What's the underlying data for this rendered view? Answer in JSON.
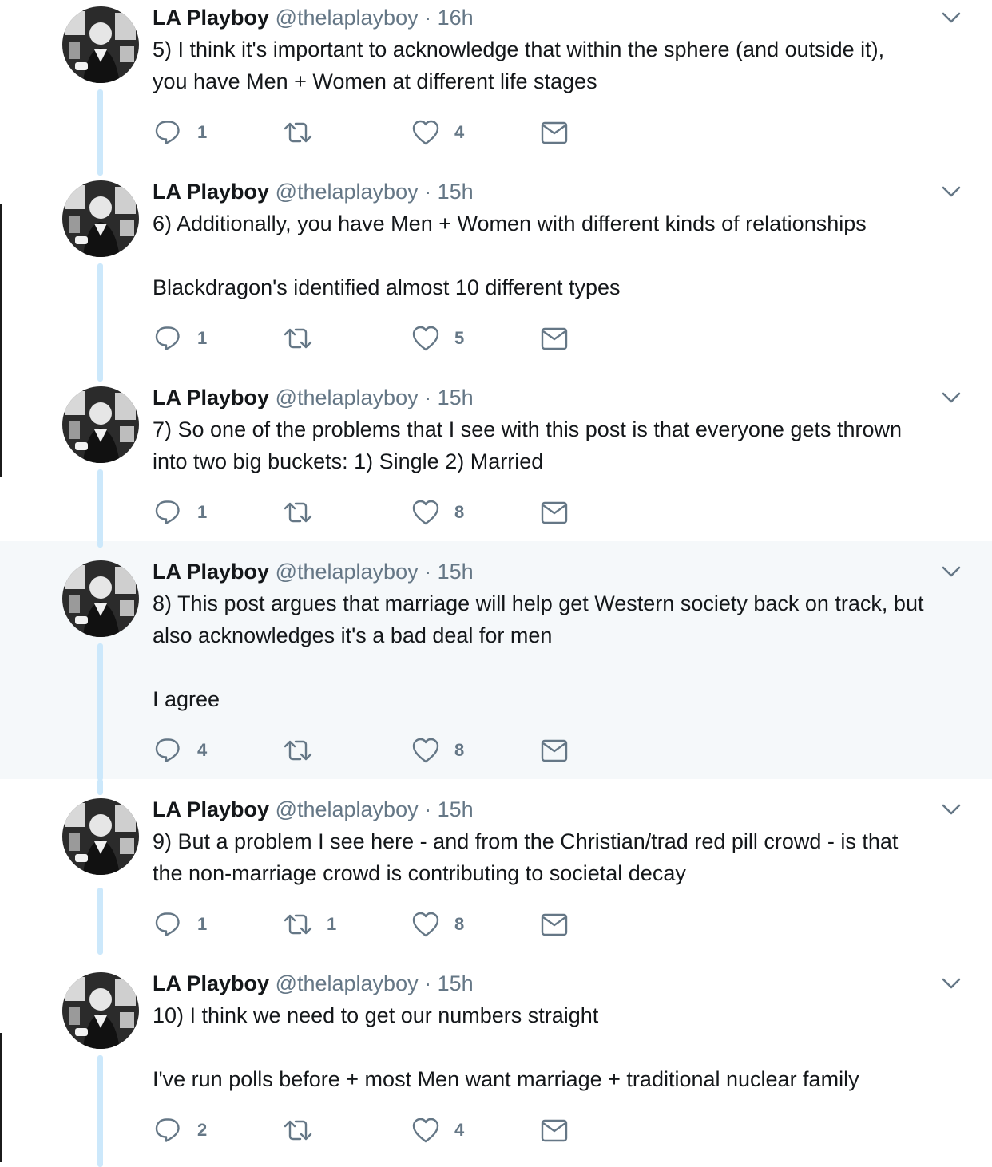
{
  "tweets": [
    {
      "name": "LA Playboy",
      "handle": "@thelaplayboy",
      "separator": "·",
      "time": "16h",
      "text": "5) I think it's important to acknowledge that within the sphere (and outside it),\nyou have Men + Women at different life stages",
      "replies": "1",
      "retweets": "",
      "likes": "4"
    },
    {
      "name": "LA Playboy",
      "handle": "@thelaplayboy",
      "separator": "·",
      "time": "15h",
      "text": "6) Additionally, you have Men + Women with different kinds of relationships\n\nBlackdragon's identified almost 10 different types",
      "replies": "1",
      "retweets": "",
      "likes": "5"
    },
    {
      "name": "LA Playboy",
      "handle": "@thelaplayboy",
      "separator": "·",
      "time": "15h",
      "text": "7) So one of the problems that I see with this post is that everyone gets thrown\ninto two big buckets: 1) Single 2) Married",
      "replies": "1",
      "retweets": "",
      "likes": "8"
    },
    {
      "name": "LA Playboy",
      "handle": "@thelaplayboy",
      "separator": "·",
      "time": "15h",
      "text": "8) This post argues that marriage will help get Western society back on track, but\nalso acknowledges it's a bad deal for men\n\nI agree",
      "replies": "4",
      "retweets": "",
      "likes": "8"
    },
    {
      "name": "LA Playboy",
      "handle": "@thelaplayboy",
      "separator": "·",
      "time": "15h",
      "text": "9) But a problem I see here - and from the Christian/trad red pill crowd - is that\nthe non-marriage crowd is contributing to societal decay",
      "replies": "1",
      "retweets": "1",
      "likes": "8"
    },
    {
      "name": "LA Playboy",
      "handle": "@thelaplayboy",
      "separator": "·",
      "time": "15h",
      "text": "10) I think we need to get our numbers straight\n\nI've run polls before + most Men want marriage + traditional nuclear family",
      "replies": "2",
      "retweets": "",
      "likes": "4"
    }
  ],
  "icons": {
    "reply": "reply-icon",
    "retweet": "retweet-icon",
    "like": "heart-icon",
    "dm": "envelope-icon",
    "menu": "chevron-down-icon"
  },
  "colors": {
    "text": "#14171a",
    "secondary": "#657786",
    "thread_line": "#cce8fb",
    "highlight_bg": "#f5f8fa"
  }
}
